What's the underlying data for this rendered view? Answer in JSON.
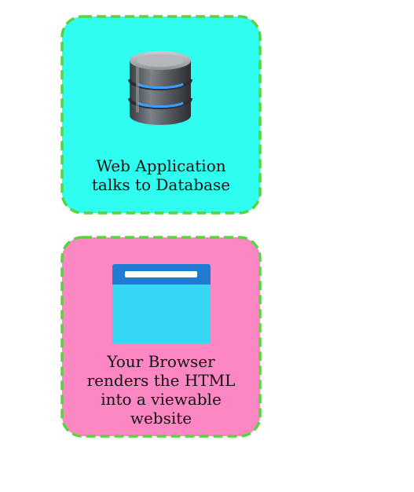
{
  "colors": {
    "card_top_fill": "#2ffdf0",
    "card_bottom_fill": "#fd87c2",
    "dashed_border": "#57d43f"
  },
  "cards": [
    {
      "icon": "database-icon",
      "lines": [
        "Web Application",
        "talks to Database"
      ]
    },
    {
      "icon": "browser-window-icon",
      "lines": [
        "Your Browser",
        "renders the HTML",
        "into a viewable",
        "website"
      ]
    }
  ]
}
